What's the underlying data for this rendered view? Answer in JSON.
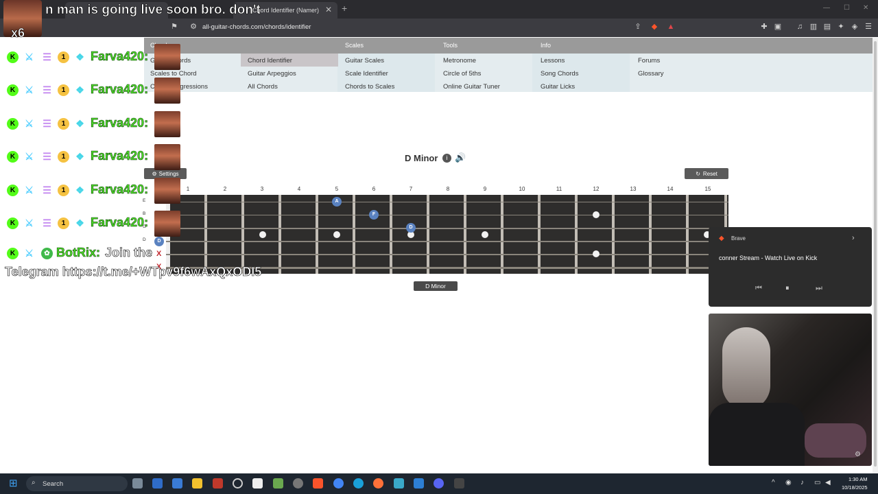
{
  "browser": {
    "tabs": [
      {
        "label": "",
        "active": false
      },
      {
        "label": "Chord Identifier (Namer)",
        "active": true
      }
    ],
    "new_tab": "+",
    "url": "all-guitar-chords.com/chords/identifier"
  },
  "site": {
    "nav_headers": [
      "Chords",
      "Scales",
      "Tools",
      "Info"
    ],
    "nav_items": {
      "chords": [
        "Guitar Chords",
        "Scales to Chord",
        "Chord Progressions"
      ],
      "chords2": [
        "Chord Identifier",
        "Guitar Arpeggios",
        "All Chords"
      ],
      "scales": [
        "Guitar Scales",
        "Scale Identifier",
        "Chords to Scales"
      ],
      "tools": [
        "Metronome",
        "Circle of 5ths",
        "Online Guitar Tuner"
      ],
      "info": [
        "Lessons",
        "Song Chords",
        "Guitar Licks"
      ],
      "info2": [
        "Forums",
        "Glossary"
      ]
    },
    "chord_name": "D Minor",
    "chord_label": "D Minor",
    "settings_label": "Settings",
    "reset_label": "Reset",
    "fret_numbers": [
      "1",
      "2",
      "3",
      "4",
      "5",
      "6",
      "7",
      "8",
      "9",
      "10",
      "11",
      "12",
      "13",
      "14",
      "15"
    ],
    "string_labels": [
      "E",
      "B",
      "G",
      "D"
    ],
    "notes": [
      {
        "label": "A",
        "string": 1,
        "fret": 5
      },
      {
        "label": "F",
        "string": 2,
        "fret": 6
      },
      {
        "label": "D",
        "string": 3,
        "fret": 7
      },
      {
        "label": "D",
        "string": 4,
        "fret": 0
      }
    ],
    "muted": [
      "X",
      "X"
    ]
  },
  "overlay": {
    "top_message": "n man is going live soon bro. don't",
    "multiplier": "x6",
    "chat": [
      {
        "user": "Farva420:",
        "message": ""
      },
      {
        "user": "Farva420:",
        "message": ""
      },
      {
        "user": "Farva420:",
        "message": ""
      },
      {
        "user": "Farva420:",
        "message": ""
      },
      {
        "user": "Farva420:",
        "message": ""
      },
      {
        "user": "Farva420:",
        "message": ""
      },
      {
        "user": "BotRix:",
        "message": "Join the"
      }
    ],
    "telegram": "Telegram https://t.me/+WTpv9f6wAxQxODI5",
    "colors": {
      "username": "#4fe02a",
      "kick": "#53fc18"
    }
  },
  "media": {
    "app": "Brave",
    "title": "conner Stream - Watch Live on Kick"
  },
  "taskbar": {
    "search": "Search",
    "time": "1:30 AM",
    "date": "10/18/2025"
  }
}
